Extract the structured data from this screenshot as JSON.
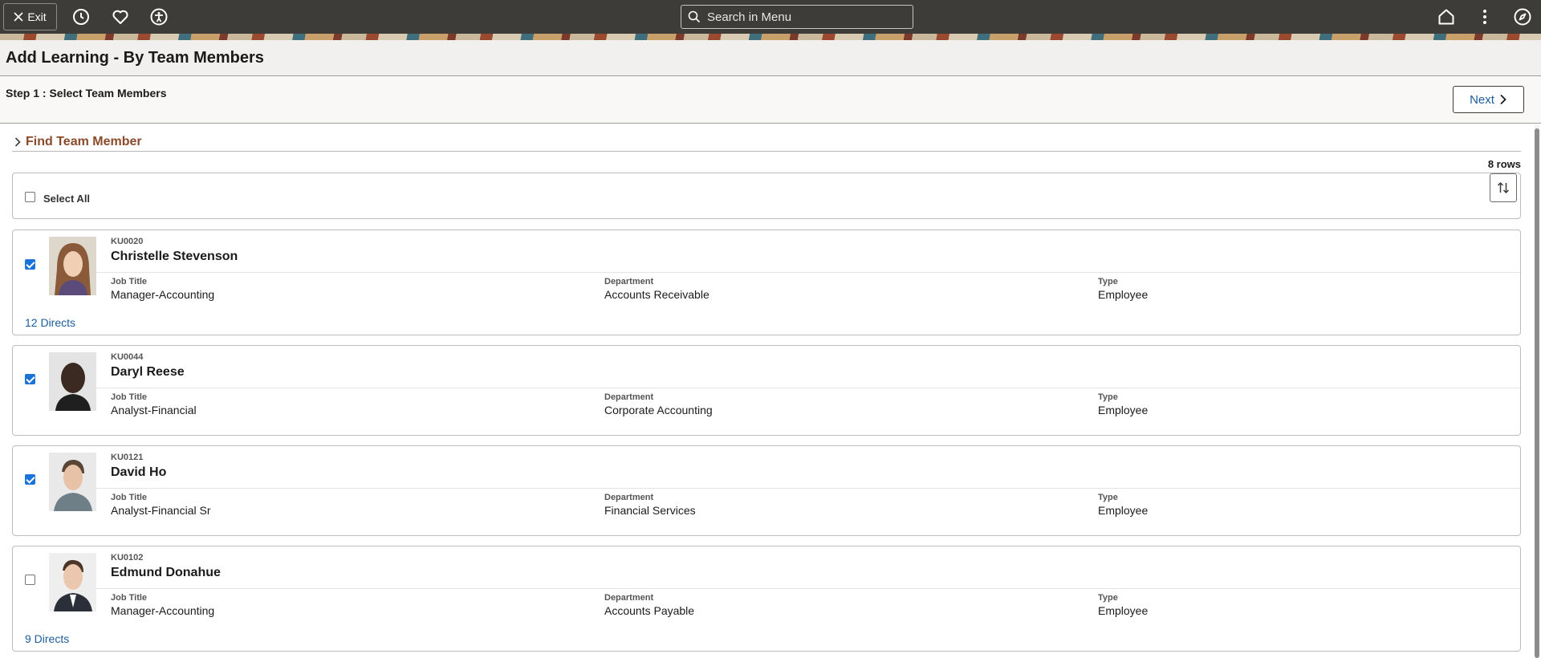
{
  "topbar": {
    "exit_label": "Exit",
    "search_placeholder": "Search in Menu"
  },
  "page": {
    "title": "Add Learning - By Team Members",
    "step_label": "Step 1 : Select Team Members",
    "next_label": "Next"
  },
  "find": {
    "title": "Find Team Member"
  },
  "list": {
    "row_count": "8 rows",
    "select_all_label": "Select All",
    "labels": {
      "job_title": "Job Title",
      "department": "Department",
      "type": "Type"
    },
    "members": [
      {
        "id": "KU0020",
        "name": "Christelle Stevenson",
        "job_title": "Manager-Accounting",
        "department": "Accounts Receivable",
        "type": "Employee",
        "checked": true,
        "directs": "12 Directs"
      },
      {
        "id": "KU0044",
        "name": "Daryl Reese",
        "job_title": "Analyst-Financial",
        "department": "Corporate Accounting",
        "type": "Employee",
        "checked": true,
        "directs": ""
      },
      {
        "id": "KU0121",
        "name": "David Ho",
        "job_title": "Analyst-Financial Sr",
        "department": "Financial Services",
        "type": "Employee",
        "checked": true,
        "directs": ""
      },
      {
        "id": "KU0102",
        "name": "Edmund Donahue",
        "job_title": "Manager-Accounting",
        "department": "Accounts Payable",
        "type": "Employee",
        "checked": false,
        "directs": "9 Directs"
      }
    ]
  },
  "colors": {
    "topbar_bg": "#3e3c39",
    "link": "#1b5d9c",
    "section_title": "#8a4a2a",
    "checkbox_on": "#1a73d9"
  }
}
